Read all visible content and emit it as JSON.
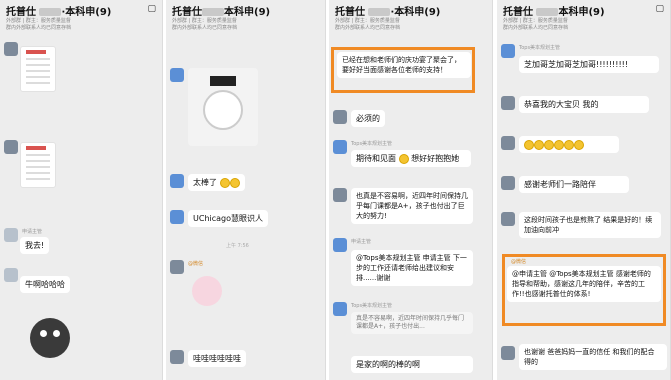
{
  "p1": {
    "title": "托普仕",
    "title_suffix": "·本科申(9)",
    "sub1": "外部群 | 群主：服务质量监督",
    "sub2": "群内外部联系人均已同意存档",
    "msg_go": "我去!",
    "msg_laugh": "牛啊哈哈哈",
    "name_label": "申请主管"
  },
  "p2": {
    "title": "托普仕",
    "title_suffix": "本科申(9)",
    "sub1": "外部群 | 群主：服务质量监督",
    "sub2": "群内外部联系人均已同意存档",
    "msg_great": "太棒了",
    "msg_uchicago": "UChicago慧眼识人",
    "time": "上午 7:56",
    "msg_wa": "哇哇哇哇哇哇",
    "wechat_tag": "@微信"
  },
  "p3": {
    "title": "托普仕",
    "title_suffix": "·本科申(9)",
    "sub1": "外部群 | 群主：服务质量监督",
    "sub2": "群内外部联系人均已同意存档",
    "msg_party": "已经在想和老师们的庆功宴了聚会了，要好好当面感谢各位老师的支持！",
    "msg_must": "必须的",
    "name_tops": "Tops美本规划主管",
    "msg_expect": "期待和见面",
    "msg_expect2": "想好好抱抱她",
    "msg_hard": "也真是不容易啊，近四年时间保持几乎每门课都是A+，孩子也付出了巨大的努力!",
    "name_plan": "申请主管",
    "msg_mention": "@Tops美本规划主管 申请主管 下一步的工作还请老师给出建议和安排......谢谢",
    "msg_hard2": "真是不容易啊，近四年时间保持几乎每门课都是A+，孩子也付出...",
    "msg_last": "是家的啊的棒的啊"
  },
  "p4": {
    "title": "托普仕",
    "title_suffix": "本科申(9)",
    "sub1": "外部群 | 群主：服务质量监督",
    "sub2": "群内外部联系人均已同意存档",
    "name_tops": "Tops美本规划主管",
    "msg_chicago": "芝加哥芝加哥芝加哥!!!!!!!!!!",
    "msg_congrats": "恭喜我的大宝贝 我的",
    "msg_thanks": "感谢老师们一路陪伴",
    "msg_year": "这段时间孩子也是煎熬了 结果是好的！续加油向前冲",
    "wechat_tag": "@微信",
    "msg_mention": "@申请主管 @Tops美本规划主管 感谢老师的指导和帮助，感谢这几年的陪伴，辛苦的工作!!也感谢托普仕的体系!",
    "msg_trust": "也谢谢 爸爸妈妈一直的信任 和我们的配合 得的"
  },
  "icons": [
    "video-icon",
    "person-icon"
  ]
}
